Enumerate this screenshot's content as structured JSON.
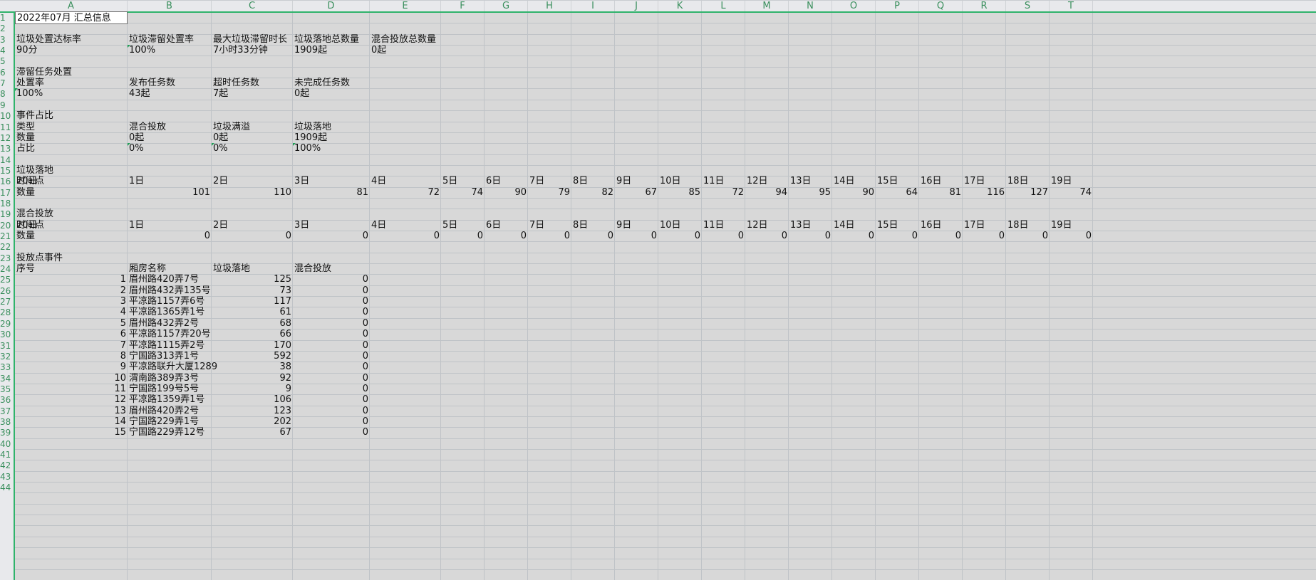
{
  "columns": [
    "A",
    "B",
    "C",
    "D",
    "E",
    "F",
    "G",
    "H",
    "I",
    "J",
    "K",
    "L",
    "M",
    "N",
    "O",
    "P",
    "Q",
    "R",
    "S",
    "T"
  ],
  "rows": [
    "1",
    "2",
    "3",
    "4",
    "5",
    "6",
    "7",
    "8",
    "9",
    "10",
    "11",
    "12",
    "13",
    "14",
    "15",
    "16",
    "17",
    "18",
    "19",
    "20",
    "21",
    "22",
    "23",
    "24",
    "25",
    "26",
    "27",
    "28",
    "29",
    "30",
    "31",
    "32",
    "33",
    "34",
    "35",
    "36",
    "37",
    "38",
    "39",
    "40",
    "41",
    "42",
    "43",
    "44"
  ],
  "summary": {
    "title": "2022年07月 汇总信息",
    "headers": [
      "垃圾处置达标率",
      "垃圾滞留处置率",
      "最大垃圾滞留时长",
      "垃圾落地总数量",
      "混合投放总数量"
    ],
    "values": [
      "90分",
      "100%",
      "7小时33分钟",
      "1909起",
      "0起"
    ]
  },
  "retention": {
    "title": "滞留任务处置",
    "headers": [
      "处置率",
      "发布任务数",
      "超时任务数",
      "未完成任务数"
    ],
    "values": [
      "100%",
      "43起",
      "7起",
      "0起"
    ]
  },
  "events": {
    "title": "事件占比",
    "rows": [
      [
        "类型",
        "混合投放",
        "垃圾满溢",
        "垃圾落地"
      ],
      [
        "数量",
        "0起",
        "0起",
        "1909起"
      ],
      [
        "占比",
        "0%",
        "0%",
        "100%"
      ]
    ]
  },
  "litter": {
    "title": "垃圾落地",
    "label_time": "时间点",
    "label_count": "数量",
    "days": [
      "1日",
      "2日",
      "3日",
      "4日",
      "5日",
      "6日",
      "7日",
      "8日",
      "9日",
      "10日",
      "11日",
      "12日",
      "13日",
      "14日",
      "15日",
      "16日",
      "17日",
      "18日",
      "19日",
      "20日"
    ],
    "counts": [
      "101",
      "110",
      "81",
      "72",
      "74",
      "90",
      "79",
      "82",
      "67",
      "85",
      "72",
      "94",
      "95",
      "90",
      "64",
      "81",
      "116",
      "127",
      "74",
      ""
    ]
  },
  "mixed": {
    "title": "混合投放",
    "label_time": "时间点",
    "label_count": "数量",
    "days": [
      "1日",
      "2日",
      "3日",
      "4日",
      "5日",
      "6日",
      "7日",
      "8日",
      "9日",
      "10日",
      "11日",
      "12日",
      "13日",
      "14日",
      "15日",
      "16日",
      "17日",
      "18日",
      "19日",
      "20日"
    ],
    "counts": [
      "0",
      "0",
      "0",
      "0",
      "0",
      "0",
      "0",
      "0",
      "0",
      "0",
      "0",
      "0",
      "0",
      "0",
      "0",
      "0",
      "0",
      "0",
      "0",
      ""
    ]
  },
  "points": {
    "title": "投放点事件",
    "headers": [
      "序号",
      "厢房名称",
      "垃圾落地",
      "混合投放"
    ],
    "rows": [
      [
        "1",
        "眉州路420弄7号",
        "125",
        "0"
      ],
      [
        "2",
        "眉州路432弄135号",
        "73",
        "0"
      ],
      [
        "3",
        "平凉路1157弄6号",
        "117",
        "0"
      ],
      [
        "4",
        "平凉路1365弄1号",
        "61",
        "0"
      ],
      [
        "5",
        "眉州路432弄2号",
        "68",
        "0"
      ],
      [
        "6",
        "平凉路1157弄20号",
        "66",
        "0"
      ],
      [
        "7",
        "平凉路1115弄2号",
        "170",
        "0"
      ],
      [
        "8",
        "宁国路313弄1号",
        "592",
        "0"
      ],
      [
        "9",
        "平凉路联升大厦1289",
        "38",
        "0"
      ],
      [
        "10",
        "渭南路389弄3号",
        "92",
        "0"
      ],
      [
        "11",
        "宁国路199号5号",
        "9",
        "0"
      ],
      [
        "12",
        "平凉路1359弄1号",
        "106",
        "0"
      ],
      [
        "13",
        "眉州路420弄2号",
        "123",
        "0"
      ],
      [
        "14",
        "宁国路229弄1号",
        "202",
        "0"
      ],
      [
        "15",
        "宁国路229弄12号",
        "67",
        "0"
      ]
    ]
  }
}
